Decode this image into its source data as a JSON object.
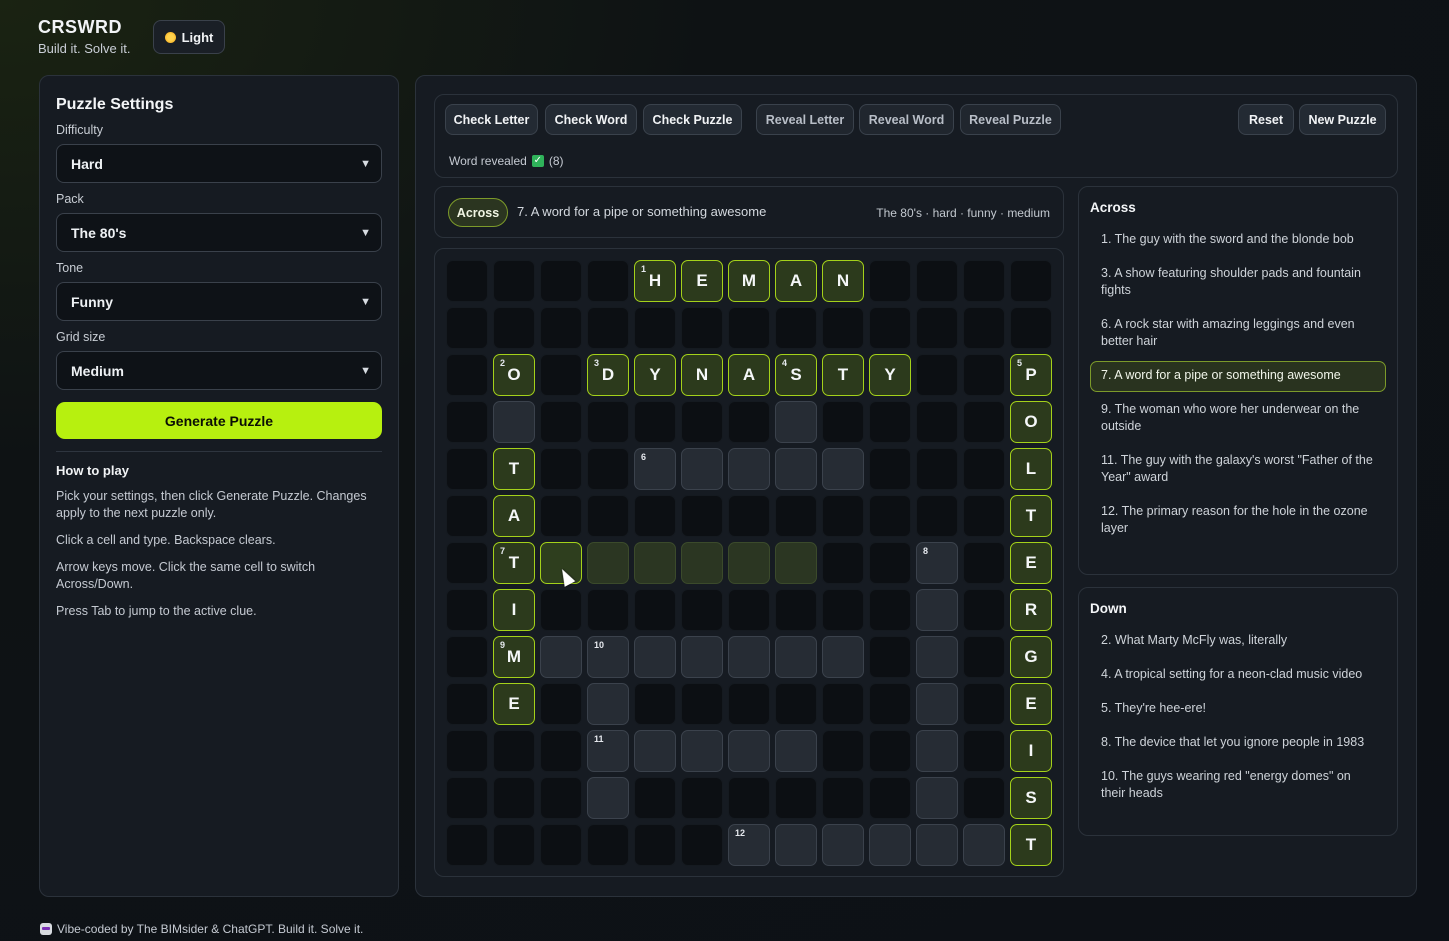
{
  "app": {
    "title": "CRSWRD",
    "tagline": "Build it. Solve it.",
    "theme_toggle_label": "Light"
  },
  "settings": {
    "heading": "Puzzle Settings",
    "fields": [
      {
        "label": "Difficulty",
        "value": "Hard"
      },
      {
        "label": "Pack",
        "value": "The 80's"
      },
      {
        "label": "Tone",
        "value": "Funny"
      },
      {
        "label": "Grid size",
        "value": "Medium"
      }
    ],
    "generate_label": "Generate Puzzle"
  },
  "how_to_play": {
    "title": "How to play",
    "lines": [
      "Pick your settings, then click Generate Puzzle. Changes apply to the next puzzle only.",
      "Click a cell and type. Backspace clears.",
      "Arrow keys move. Click the same cell to switch Across/Down.",
      "Press Tab to jump to the active clue."
    ]
  },
  "toolbar": {
    "check_letter": "Check Letter",
    "check_word": "Check Word",
    "check_puzzle": "Check Puzzle",
    "reveal_letter": "Reveal Letter",
    "reveal_word": "Reveal Word",
    "reveal_puzzle": "Reveal Puzzle",
    "reset": "Reset",
    "new_puzzle": "New Puzzle",
    "status_text": "Word revealed",
    "status_count": "(8)"
  },
  "active_clue": {
    "direction": "Across",
    "text": "7. A word for a pipe or something awesome",
    "meta": "The 80's · hard · funny · medium"
  },
  "grid": {
    "size": 13,
    "rows": [
      "####HEMAN####",
      "#############",
      "#O#DYNASTY##P",
      "#.#####.####O",
      "#T##.....###L",
      "#A##########T",
      "#T......##.#E",
      "#I########.#R",
      "#M.......#.#G",
      "#E#.######.#E",
      "###.....##.#I",
      "###.######.#S",
      "######......T"
    ],
    "numbers": [
      {
        "r": 0,
        "c": 4,
        "n": "1"
      },
      {
        "r": 2,
        "c": 1,
        "n": "2"
      },
      {
        "r": 2,
        "c": 3,
        "n": "3"
      },
      {
        "r": 2,
        "c": 7,
        "n": "4"
      },
      {
        "r": 2,
        "c": 12,
        "n": "5"
      },
      {
        "r": 4,
        "c": 4,
        "n": "6"
      },
      {
        "r": 6,
        "c": 1,
        "n": "7"
      },
      {
        "r": 6,
        "c": 10,
        "n": "8"
      },
      {
        "r": 8,
        "c": 1,
        "n": "9"
      },
      {
        "r": 8,
        "c": 3,
        "n": "10"
      },
      {
        "r": 10,
        "c": 3,
        "n": "11"
      },
      {
        "r": 12,
        "c": 6,
        "n": "12"
      }
    ],
    "active_cell": {
      "r": 6,
      "c": 2
    },
    "highlighted_word": {
      "r": 6,
      "c_start": 1,
      "c_end": 7
    }
  },
  "clues": {
    "across_title": "Across",
    "across": [
      "1. The guy with the sword and the blonde bob",
      "3. A show featuring shoulder pads and fountain fights",
      "6. A rock star with amazing leggings and even better hair",
      "7. A word for a pipe or something awesome",
      "9. The woman who wore her underwear on the outside",
      "11. The guy with the galaxy's worst \"Father of the Year\" award",
      "12. The primary reason for the hole in the ozone layer"
    ],
    "selected_across_index": 3,
    "down_title": "Down",
    "down": [
      "2. What Marty McFly was, literally",
      "4. A tropical setting for a neon-clad music video",
      "5. They're hee-ere!",
      "8. The device that let you ignore people in 1983",
      "10. The guys wearing red \"energy domes\" on their heads"
    ]
  },
  "footer": {
    "text": "Vibe-coded by The BIMsider & ChatGPT. Build it. Solve it."
  },
  "colors": {
    "accent": "#b7f00f",
    "background": "#0d1117",
    "panel": "#161b22"
  }
}
